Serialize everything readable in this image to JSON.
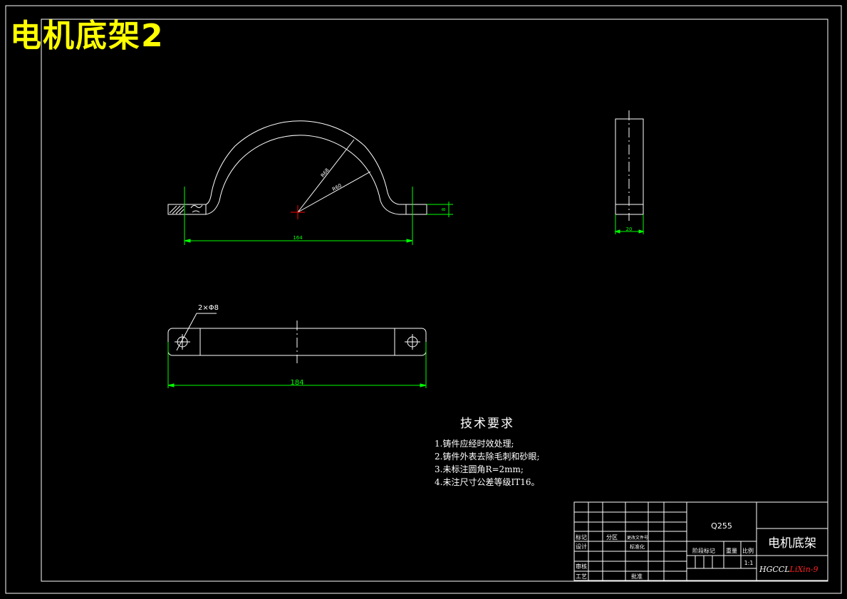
{
  "drawing": {
    "title": "电机底架2",
    "colors": {
      "outline": "#ffffff",
      "dimension": "#00ff00",
      "center": "#ff0000",
      "title": "#ffff00",
      "frame": "#ffffff"
    }
  },
  "dimensions": {
    "front_radius_outer": "R68",
    "front_radius_inner": "R60",
    "front_length": "164",
    "front_thickness": "8",
    "side_width": "20",
    "top_holes": "2×Φ8",
    "top_length": "184"
  },
  "tech_requirements": {
    "heading": "技术要求",
    "items": [
      "1.铸件应经时效处理;",
      "2.铸件外表去除毛刺和砂眼;",
      "3.未标注圆角R=2mm;",
      "4.未注尺寸公差等级IT16。"
    ]
  },
  "title_block": {
    "material": "Q255",
    "part_name": "电机底架",
    "scale": "1:1",
    "code": "HGCCL LiXin-9",
    "labels": {
      "mark": "标记",
      "zone": "分区",
      "change_doc": "更改文件号",
      "design": "设计",
      "standardize": "标准化",
      "stage_mark": "阶段标记",
      "weight": "重量",
      "ratio": "比例",
      "review": "审核",
      "process": "工艺",
      "approve": "批准"
    }
  }
}
